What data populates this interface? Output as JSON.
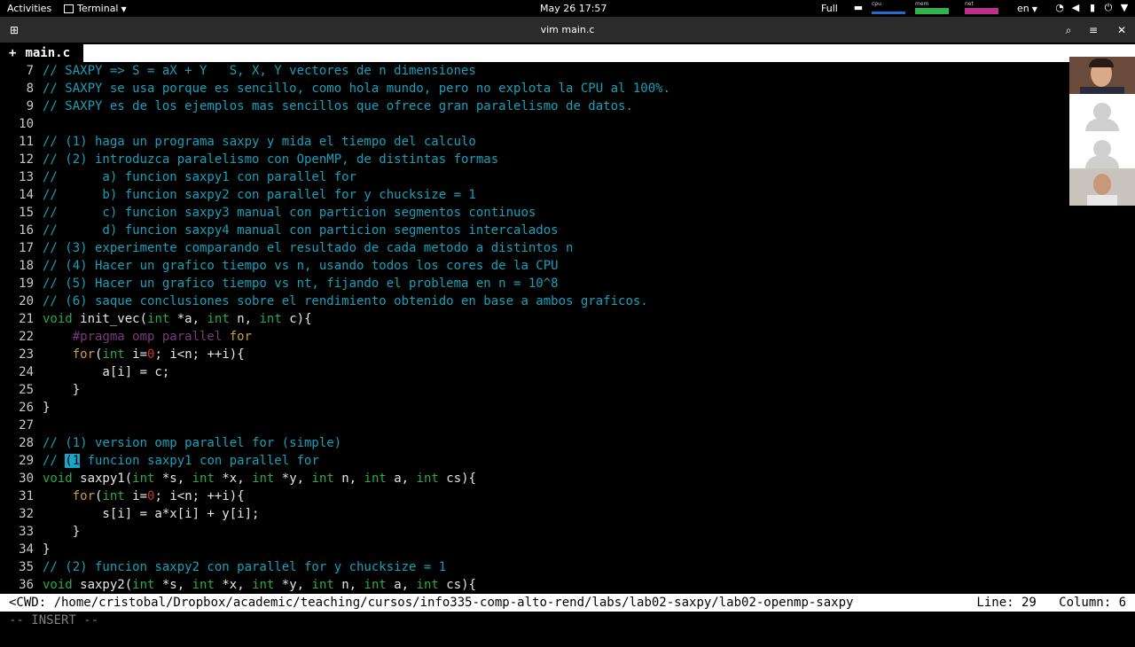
{
  "topbar": {
    "activities": "Activities",
    "app_menu": "Terminal",
    "clock": "May 26  17:57",
    "full": "Full",
    "graphs": [
      {
        "label": "cpu",
        "color": "#1e6fd0",
        "level": 0.25
      },
      {
        "label": "mem",
        "color": "#2fb34a",
        "level": 0.55
      },
      {
        "label": "net",
        "color": "#c0308a",
        "level": 0.6
      }
    ],
    "lang": "en"
  },
  "titlebar": {
    "title": "vim main.c"
  },
  "tabline": {
    "active_tab": "main.c",
    "plus": "+"
  },
  "code_lines": [
    {
      "n": "7",
      "tokens": [
        {
          "t": "// SAXPY => S = aX + Y   S, X, Y vectores de n dimensiones",
          "c": "comment"
        }
      ]
    },
    {
      "n": "8",
      "tokens": [
        {
          "t": "// SAXPY se usa porque es sencillo, como hola mundo, pero no explota la CPU al 100%.",
          "c": "comment"
        }
      ]
    },
    {
      "n": "9",
      "tokens": [
        {
          "t": "// SAXPY es de los ejemplos mas sencillos que ofrece gran paralelismo de datos.",
          "c": "comment"
        }
      ]
    },
    {
      "n": "10",
      "tokens": []
    },
    {
      "n": "11",
      "tokens": [
        {
          "t": "// (1) haga un programa saxpy y mida el tiempo del calculo",
          "c": "comment"
        }
      ]
    },
    {
      "n": "12",
      "tokens": [
        {
          "t": "// (2) introduzca paralelismo con OpenMP, de distintas formas",
          "c": "comment"
        }
      ]
    },
    {
      "n": "13",
      "tokens": [
        {
          "t": "//      a) funcion saxpy1 con parallel for",
          "c": "comment"
        }
      ]
    },
    {
      "n": "14",
      "tokens": [
        {
          "t": "//      b) funcion saxpy2 con parallel for y chucksize = 1",
          "c": "comment"
        }
      ]
    },
    {
      "n": "15",
      "tokens": [
        {
          "t": "//      c) funcion saxpy3 manual con particion segmentos continuos",
          "c": "comment"
        }
      ]
    },
    {
      "n": "16",
      "tokens": [
        {
          "t": "//      d) funcion saxpy4 manual con particion segmentos intercalados",
          "c": "comment"
        }
      ]
    },
    {
      "n": "17",
      "tokens": [
        {
          "t": "// (3) experimente comparando el resultado de cada metodo a distintos n",
          "c": "comment"
        }
      ]
    },
    {
      "n": "18",
      "tokens": [
        {
          "t": "// (4) Hacer un grafico tiempo vs n, usando todos los cores de la CPU",
          "c": "comment"
        }
      ]
    },
    {
      "n": "19",
      "tokens": [
        {
          "t": "// (5) Hacer un grafico tiempo vs nt, fijando el problema en n = 10^8",
          "c": "comment"
        }
      ]
    },
    {
      "n": "20",
      "tokens": [
        {
          "t": "// (6) saque conclusiones sobre el rendimiento obtenido en base a ambos graficos.",
          "c": "comment"
        }
      ]
    },
    {
      "n": "21",
      "tokens": [
        {
          "t": "void",
          "c": "type"
        },
        {
          "t": " init_vec(",
          "c": "plain"
        },
        {
          "t": "int",
          "c": "type"
        },
        {
          "t": " *a, ",
          "c": "plain"
        },
        {
          "t": "int",
          "c": "type"
        },
        {
          "t": " n, ",
          "c": "plain"
        },
        {
          "t": "int",
          "c": "type"
        },
        {
          "t": " c){",
          "c": "plain"
        }
      ]
    },
    {
      "n": "22",
      "tokens": [
        {
          "t": "    ",
          "c": "plain"
        },
        {
          "t": "#pragma omp parallel",
          "c": "pre"
        },
        {
          "t": " for",
          "c": "kw"
        }
      ]
    },
    {
      "n": "23",
      "tokens": [
        {
          "t": "    ",
          "c": "plain"
        },
        {
          "t": "for",
          "c": "kw"
        },
        {
          "t": "(",
          "c": "plain"
        },
        {
          "t": "int",
          "c": "type"
        },
        {
          "t": " i=",
          "c": "plain"
        },
        {
          "t": "0",
          "c": "num"
        },
        {
          "t": "; i<n; ++i){",
          "c": "plain"
        }
      ]
    },
    {
      "n": "24",
      "tokens": [
        {
          "t": "        a[i] = c;",
          "c": "plain"
        }
      ]
    },
    {
      "n": "25",
      "tokens": [
        {
          "t": "    }",
          "c": "plain"
        }
      ]
    },
    {
      "n": "26",
      "tokens": [
        {
          "t": "}",
          "c": "plain"
        }
      ]
    },
    {
      "n": "27",
      "tokens": []
    },
    {
      "n": "28",
      "tokens": [
        {
          "t": "// (1) version omp parallel for (simple)",
          "c": "comment"
        }
      ]
    },
    {
      "n": "29",
      "tokens": [
        {
          "t": "// ",
          "c": "comment"
        },
        {
          "t": "(1",
          "c": "cursor"
        },
        {
          "t": " funcion saxpy1 con parallel for",
          "c": "comment"
        }
      ]
    },
    {
      "n": "30",
      "tokens": [
        {
          "t": "void",
          "c": "type"
        },
        {
          "t": " saxpy1(",
          "c": "plain"
        },
        {
          "t": "int",
          "c": "type"
        },
        {
          "t": " *s, ",
          "c": "plain"
        },
        {
          "t": "int",
          "c": "type"
        },
        {
          "t": " *x, ",
          "c": "plain"
        },
        {
          "t": "int",
          "c": "type"
        },
        {
          "t": " *y, ",
          "c": "plain"
        },
        {
          "t": "int",
          "c": "type"
        },
        {
          "t": " n, ",
          "c": "plain"
        },
        {
          "t": "int",
          "c": "type"
        },
        {
          "t": " a, ",
          "c": "plain"
        },
        {
          "t": "int",
          "c": "type"
        },
        {
          "t": " cs){",
          "c": "plain"
        }
      ]
    },
    {
      "n": "31",
      "tokens": [
        {
          "t": "    ",
          "c": "plain"
        },
        {
          "t": "for",
          "c": "kw"
        },
        {
          "t": "(",
          "c": "plain"
        },
        {
          "t": "int",
          "c": "type"
        },
        {
          "t": " i=",
          "c": "plain"
        },
        {
          "t": "0",
          "c": "num"
        },
        {
          "t": "; i<n; ++i){",
          "c": "plain"
        }
      ]
    },
    {
      "n": "32",
      "tokens": [
        {
          "t": "        s[i] = a*x[i] + y[i];",
          "c": "plain"
        }
      ]
    },
    {
      "n": "33",
      "tokens": [
        {
          "t": "    }",
          "c": "plain"
        }
      ]
    },
    {
      "n": "34",
      "tokens": [
        {
          "t": "}",
          "c": "plain"
        }
      ]
    },
    {
      "n": "35",
      "tokens": [
        {
          "t": "// (2) funcion saxpy2 con parallel for y chucksize = 1",
          "c": "comment"
        }
      ]
    },
    {
      "n": "36",
      "tokens": [
        {
          "t": "void",
          "c": "type"
        },
        {
          "t": " saxpy2(",
          "c": "plain"
        },
        {
          "t": "int",
          "c": "type"
        },
        {
          "t": " *s, ",
          "c": "plain"
        },
        {
          "t": "int",
          "c": "type"
        },
        {
          "t": " *x, ",
          "c": "plain"
        },
        {
          "t": "int",
          "c": "type"
        },
        {
          "t": " *y, ",
          "c": "plain"
        },
        {
          "t": "int",
          "c": "type"
        },
        {
          "t": " n, ",
          "c": "plain"
        },
        {
          "t": "int",
          "c": "type"
        },
        {
          "t": " a, ",
          "c": "plain"
        },
        {
          "t": "int",
          "c": "type"
        },
        {
          "t": " cs){",
          "c": "plain"
        }
      ]
    }
  ],
  "statusline": {
    "cwd": "<CWD: /home/cristobal/Dropbox/academic/teaching/cursos/info335-comp-alto-rend/labs/lab02-saxpy/lab02-openmp-saxpy",
    "position": "Line: 29   Column: 6"
  },
  "mode": "-- INSERT --",
  "colors": {
    "comment": "#18a0b8",
    "type": "#2ba84a",
    "keyword": "#c8a032",
    "number": "#c83232",
    "cursor": "#1aa6c6"
  }
}
